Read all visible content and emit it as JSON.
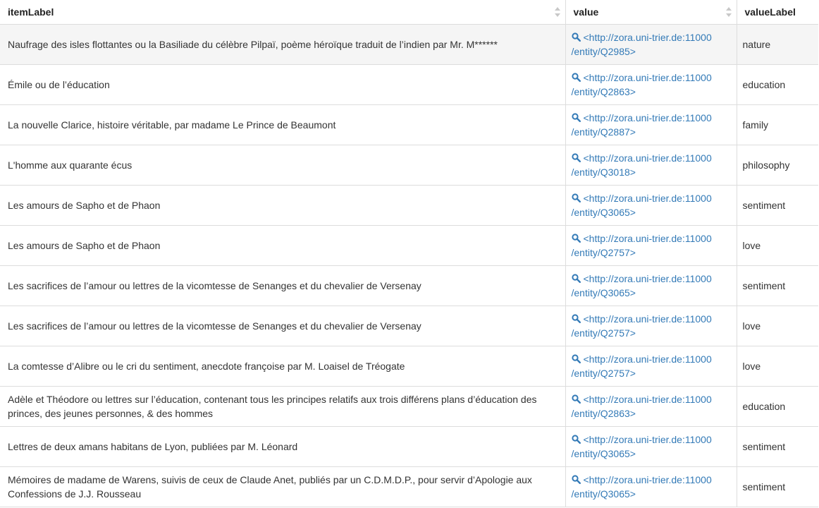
{
  "columns": [
    "itemLabel",
    "value",
    "valueLabel"
  ],
  "rows": [
    {
      "itemLabel": "Naufrage des isles flottantes ou la Basiliade du célèbre Pilpaï, poème héroïque traduit de l’indien par Mr. M******",
      "value_line1": "<http://zora.uni-trier.de:11000",
      "value_line2": "/entity/Q2985>",
      "valueLabel": "nature"
    },
    {
      "itemLabel": "Émile ou de l’éducation",
      "value_line1": "<http://zora.uni-trier.de:11000",
      "value_line2": "/entity/Q2863>",
      "valueLabel": "education"
    },
    {
      "itemLabel": "La nouvelle Clarice, histoire véritable, par madame Le Prince de Beaumont",
      "value_line1": "<http://zora.uni-trier.de:11000",
      "value_line2": "/entity/Q2887>",
      "valueLabel": "family"
    },
    {
      "itemLabel": "L'homme aux quarante écus",
      "value_line1": "<http://zora.uni-trier.de:11000",
      "value_line2": "/entity/Q3018>",
      "valueLabel": "philosophy"
    },
    {
      "itemLabel": "Les amours de Sapho et de Phaon",
      "value_line1": "<http://zora.uni-trier.de:11000",
      "value_line2": "/entity/Q3065>",
      "valueLabel": "sentiment"
    },
    {
      "itemLabel": "Les amours de Sapho et de Phaon",
      "value_line1": "<http://zora.uni-trier.de:11000",
      "value_line2": "/entity/Q2757>",
      "valueLabel": "love"
    },
    {
      "itemLabel": "Les sacrifices de l’amour ou lettres de la vicomtesse de Senanges et du chevalier de Versenay",
      "value_line1": "<http://zora.uni-trier.de:11000",
      "value_line2": "/entity/Q3065>",
      "valueLabel": "sentiment"
    },
    {
      "itemLabel": "Les sacrifices de l’amour ou lettres de la vicomtesse de Senanges et du chevalier de Versenay",
      "value_line1": "<http://zora.uni-trier.de:11000",
      "value_line2": "/entity/Q2757>",
      "valueLabel": "love"
    },
    {
      "itemLabel": "La comtesse d’Alibre ou le cri du sentiment, anecdote françoise par M. Loaisel de Tréogate",
      "value_line1": "<http://zora.uni-trier.de:11000",
      "value_line2": "/entity/Q2757>",
      "valueLabel": "love"
    },
    {
      "itemLabel": "Adèle et Théodore ou lettres sur l’éducation, contenant tous les principes relatifs aux trois différens plans d’éducation des princes, des jeunes personnes, & des hommes",
      "value_line1": "<http://zora.uni-trier.de:11000",
      "value_line2": "/entity/Q2863>",
      "valueLabel": "education"
    },
    {
      "itemLabel": "Lettres de deux amans habitans de Lyon, publiées par M. Léonard",
      "value_line1": "<http://zora.uni-trier.de:11000",
      "value_line2": "/entity/Q3065>",
      "valueLabel": "sentiment"
    },
    {
      "itemLabel": "Mémoires de madame de Warens, suivis de ceux de Claude Anet, publiés par un C.D.M.D.P., pour servir d’Apologie aux Confessions de J.J. Rousseau",
      "value_line1": "<http://zora.uni-trier.de:11000",
      "value_line2": "/entity/Q3065>",
      "valueLabel": "sentiment"
    }
  ],
  "icons": {
    "sort": "sort-icon",
    "explore": "magnifier-icon"
  },
  "colors": {
    "link": "#337ab7",
    "border": "#dddddd",
    "row_highlight": "#f5f5f5"
  }
}
